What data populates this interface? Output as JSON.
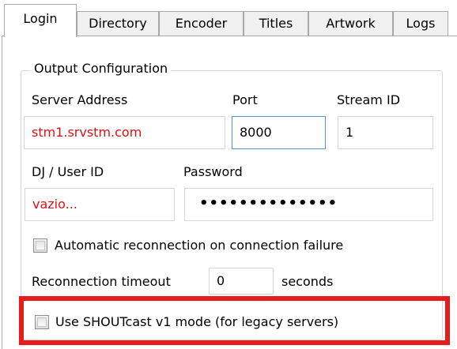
{
  "tabs": [
    {
      "label": "Login",
      "active": true
    },
    {
      "label": "Directory",
      "active": false
    },
    {
      "label": "Encoder",
      "active": false
    },
    {
      "label": "Titles",
      "active": false
    },
    {
      "label": "Artwork",
      "active": false
    },
    {
      "label": "Logs",
      "active": false
    }
  ],
  "group": {
    "title": "Output Configuration"
  },
  "fields": {
    "server_address": {
      "label": "Server Address",
      "value": "stm1.srvstm.com"
    },
    "port": {
      "label": "Port",
      "value": "8000"
    },
    "stream_id": {
      "label": "Stream ID",
      "value": "1"
    },
    "user_id": {
      "label": "DJ / User ID",
      "value": "vazio..."
    },
    "password": {
      "label": "Password",
      "value": "••••••••••••••"
    },
    "reconnection_timeout": {
      "label": "Reconnection timeout",
      "value": "0",
      "unit": "seconds"
    }
  },
  "options": {
    "auto_reconnect": {
      "label": "Automatic reconnection on connection failure",
      "checked": false
    },
    "shoutcast_v1": {
      "label": "Use SHOUTcast v1 mode (for legacy servers)",
      "checked": false
    }
  },
  "colors": {
    "highlight": "#e61b1b",
    "field_text_red": "#e01010",
    "focus_border": "#5b8fd8"
  }
}
